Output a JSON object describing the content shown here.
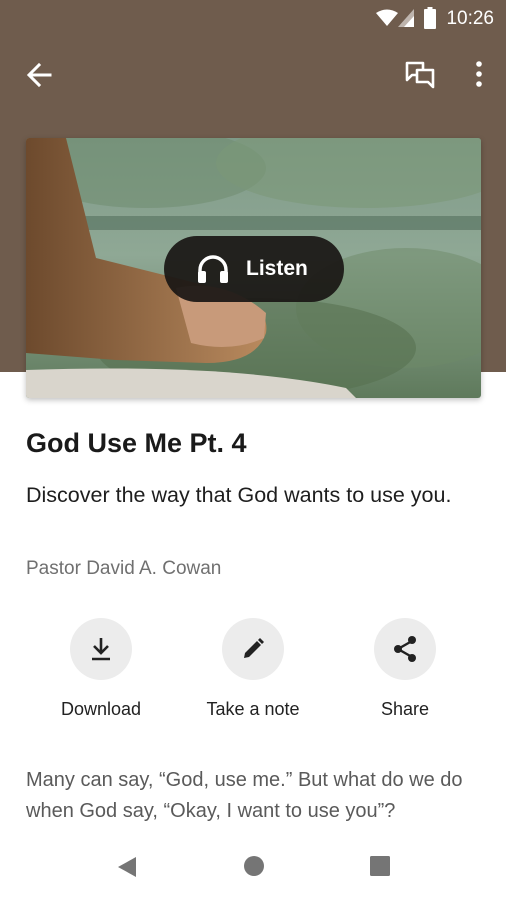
{
  "status_bar": {
    "time": "10:26"
  },
  "episode": {
    "title": "God Use Me Pt. 4",
    "description": "Discover the way that God wants to use you.",
    "author": "Pastor David A. Cowan",
    "listen_label": "Listen"
  },
  "actions": {
    "download_label": "Download",
    "note_label": "Take a note",
    "share_label": "Share"
  },
  "body": {
    "text": "Many can say, “God, use me.” But what do we do when God say, “Okay, I want to use you”?"
  },
  "colors": {
    "header": "#6f5c4d",
    "listen_button": "#191614",
    "action_circle": "#ececec"
  },
  "icons": {
    "back": "arrow-back-icon",
    "chat": "chat-icon",
    "more": "more-vert-icon",
    "listen": "headphones-icon",
    "download": "download-icon",
    "note": "pencil-icon",
    "share": "share-icon"
  }
}
